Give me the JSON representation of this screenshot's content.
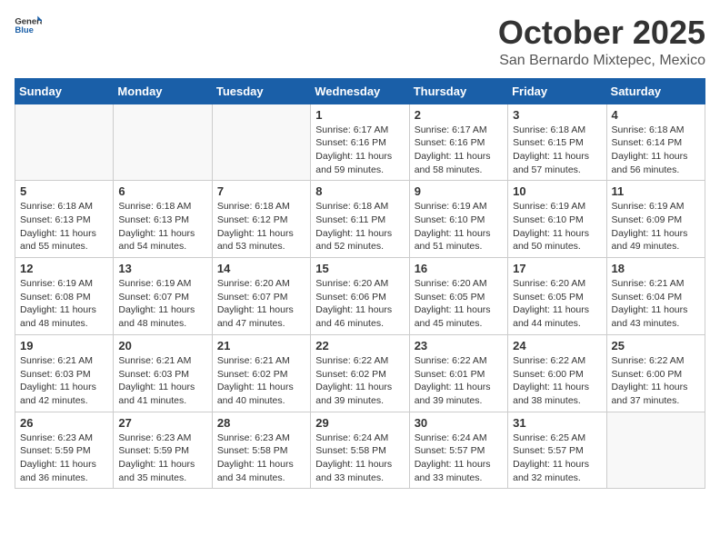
{
  "logo": {
    "text_general": "General",
    "text_blue": "Blue"
  },
  "title": "October 2025",
  "subtitle": "San Bernardo Mixtepec, Mexico",
  "days_of_week": [
    "Sunday",
    "Monday",
    "Tuesday",
    "Wednesday",
    "Thursday",
    "Friday",
    "Saturday"
  ],
  "weeks": [
    [
      {
        "day": "",
        "empty": true
      },
      {
        "day": "",
        "empty": true
      },
      {
        "day": "",
        "empty": true
      },
      {
        "day": "1",
        "sunrise": "6:17 AM",
        "sunset": "6:16 PM",
        "daylight": "11 hours and 59 minutes."
      },
      {
        "day": "2",
        "sunrise": "6:17 AM",
        "sunset": "6:16 PM",
        "daylight": "11 hours and 58 minutes."
      },
      {
        "day": "3",
        "sunrise": "6:18 AM",
        "sunset": "6:15 PM",
        "daylight": "11 hours and 57 minutes."
      },
      {
        "day": "4",
        "sunrise": "6:18 AM",
        "sunset": "6:14 PM",
        "daylight": "11 hours and 56 minutes."
      }
    ],
    [
      {
        "day": "5",
        "sunrise": "6:18 AM",
        "sunset": "6:13 PM",
        "daylight": "11 hours and 55 minutes."
      },
      {
        "day": "6",
        "sunrise": "6:18 AM",
        "sunset": "6:13 PM",
        "daylight": "11 hours and 54 minutes."
      },
      {
        "day": "7",
        "sunrise": "6:18 AM",
        "sunset": "6:12 PM",
        "daylight": "11 hours and 53 minutes."
      },
      {
        "day": "8",
        "sunrise": "6:18 AM",
        "sunset": "6:11 PM",
        "daylight": "11 hours and 52 minutes."
      },
      {
        "day": "9",
        "sunrise": "6:19 AM",
        "sunset": "6:10 PM",
        "daylight": "11 hours and 51 minutes."
      },
      {
        "day": "10",
        "sunrise": "6:19 AM",
        "sunset": "6:10 PM",
        "daylight": "11 hours and 50 minutes."
      },
      {
        "day": "11",
        "sunrise": "6:19 AM",
        "sunset": "6:09 PM",
        "daylight": "11 hours and 49 minutes."
      }
    ],
    [
      {
        "day": "12",
        "sunrise": "6:19 AM",
        "sunset": "6:08 PM",
        "daylight": "11 hours and 48 minutes."
      },
      {
        "day": "13",
        "sunrise": "6:19 AM",
        "sunset": "6:07 PM",
        "daylight": "11 hours and 48 minutes."
      },
      {
        "day": "14",
        "sunrise": "6:20 AM",
        "sunset": "6:07 PM",
        "daylight": "11 hours and 47 minutes."
      },
      {
        "day": "15",
        "sunrise": "6:20 AM",
        "sunset": "6:06 PM",
        "daylight": "11 hours and 46 minutes."
      },
      {
        "day": "16",
        "sunrise": "6:20 AM",
        "sunset": "6:05 PM",
        "daylight": "11 hours and 45 minutes."
      },
      {
        "day": "17",
        "sunrise": "6:20 AM",
        "sunset": "6:05 PM",
        "daylight": "11 hours and 44 minutes."
      },
      {
        "day": "18",
        "sunrise": "6:21 AM",
        "sunset": "6:04 PM",
        "daylight": "11 hours and 43 minutes."
      }
    ],
    [
      {
        "day": "19",
        "sunrise": "6:21 AM",
        "sunset": "6:03 PM",
        "daylight": "11 hours and 42 minutes."
      },
      {
        "day": "20",
        "sunrise": "6:21 AM",
        "sunset": "6:03 PM",
        "daylight": "11 hours and 41 minutes."
      },
      {
        "day": "21",
        "sunrise": "6:21 AM",
        "sunset": "6:02 PM",
        "daylight": "11 hours and 40 minutes."
      },
      {
        "day": "22",
        "sunrise": "6:22 AM",
        "sunset": "6:02 PM",
        "daylight": "11 hours and 39 minutes."
      },
      {
        "day": "23",
        "sunrise": "6:22 AM",
        "sunset": "6:01 PM",
        "daylight": "11 hours and 39 minutes."
      },
      {
        "day": "24",
        "sunrise": "6:22 AM",
        "sunset": "6:00 PM",
        "daylight": "11 hours and 38 minutes."
      },
      {
        "day": "25",
        "sunrise": "6:22 AM",
        "sunset": "6:00 PM",
        "daylight": "11 hours and 37 minutes."
      }
    ],
    [
      {
        "day": "26",
        "sunrise": "6:23 AM",
        "sunset": "5:59 PM",
        "daylight": "11 hours and 36 minutes."
      },
      {
        "day": "27",
        "sunrise": "6:23 AM",
        "sunset": "5:59 PM",
        "daylight": "11 hours and 35 minutes."
      },
      {
        "day": "28",
        "sunrise": "6:23 AM",
        "sunset": "5:58 PM",
        "daylight": "11 hours and 34 minutes."
      },
      {
        "day": "29",
        "sunrise": "6:24 AM",
        "sunset": "5:58 PM",
        "daylight": "11 hours and 33 minutes."
      },
      {
        "day": "30",
        "sunrise": "6:24 AM",
        "sunset": "5:57 PM",
        "daylight": "11 hours and 33 minutes."
      },
      {
        "day": "31",
        "sunrise": "6:25 AM",
        "sunset": "5:57 PM",
        "daylight": "11 hours and 32 minutes."
      },
      {
        "day": "",
        "empty": true
      }
    ]
  ],
  "labels": {
    "sunrise": "Sunrise:",
    "sunset": "Sunset:",
    "daylight": "Daylight:"
  }
}
